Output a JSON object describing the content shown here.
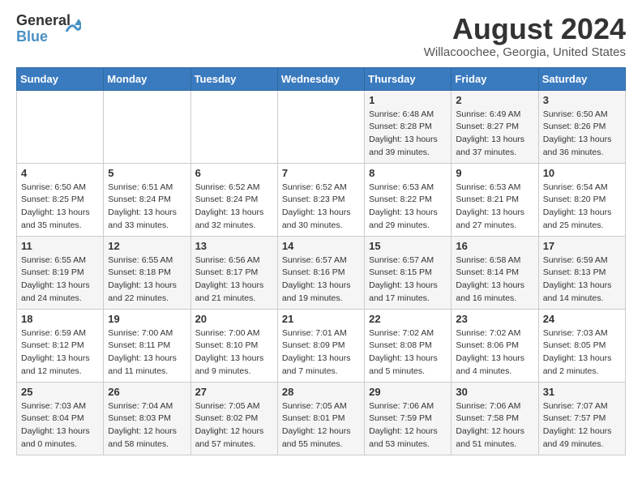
{
  "header": {
    "logo_general": "General",
    "logo_blue": "Blue",
    "month_year": "August 2024",
    "location": "Willacoochee, Georgia, United States"
  },
  "weekdays": [
    "Sunday",
    "Monday",
    "Tuesday",
    "Wednesday",
    "Thursday",
    "Friday",
    "Saturday"
  ],
  "weeks": [
    [
      {
        "day": "",
        "sunrise": "",
        "sunset": "",
        "daylight": ""
      },
      {
        "day": "",
        "sunrise": "",
        "sunset": "",
        "daylight": ""
      },
      {
        "day": "",
        "sunrise": "",
        "sunset": "",
        "daylight": ""
      },
      {
        "day": "",
        "sunrise": "",
        "sunset": "",
        "daylight": ""
      },
      {
        "day": "1",
        "sunrise": "Sunrise: 6:48 AM",
        "sunset": "Sunset: 8:28 PM",
        "daylight": "Daylight: 13 hours and 39 minutes."
      },
      {
        "day": "2",
        "sunrise": "Sunrise: 6:49 AM",
        "sunset": "Sunset: 8:27 PM",
        "daylight": "Daylight: 13 hours and 37 minutes."
      },
      {
        "day": "3",
        "sunrise": "Sunrise: 6:50 AM",
        "sunset": "Sunset: 8:26 PM",
        "daylight": "Daylight: 13 hours and 36 minutes."
      }
    ],
    [
      {
        "day": "4",
        "sunrise": "Sunrise: 6:50 AM",
        "sunset": "Sunset: 8:25 PM",
        "daylight": "Daylight: 13 hours and 35 minutes."
      },
      {
        "day": "5",
        "sunrise": "Sunrise: 6:51 AM",
        "sunset": "Sunset: 8:24 PM",
        "daylight": "Daylight: 13 hours and 33 minutes."
      },
      {
        "day": "6",
        "sunrise": "Sunrise: 6:52 AM",
        "sunset": "Sunset: 8:24 PM",
        "daylight": "Daylight: 13 hours and 32 minutes."
      },
      {
        "day": "7",
        "sunrise": "Sunrise: 6:52 AM",
        "sunset": "Sunset: 8:23 PM",
        "daylight": "Daylight: 13 hours and 30 minutes."
      },
      {
        "day": "8",
        "sunrise": "Sunrise: 6:53 AM",
        "sunset": "Sunset: 8:22 PM",
        "daylight": "Daylight: 13 hours and 29 minutes."
      },
      {
        "day": "9",
        "sunrise": "Sunrise: 6:53 AM",
        "sunset": "Sunset: 8:21 PM",
        "daylight": "Daylight: 13 hours and 27 minutes."
      },
      {
        "day": "10",
        "sunrise": "Sunrise: 6:54 AM",
        "sunset": "Sunset: 8:20 PM",
        "daylight": "Daylight: 13 hours and 25 minutes."
      }
    ],
    [
      {
        "day": "11",
        "sunrise": "Sunrise: 6:55 AM",
        "sunset": "Sunset: 8:19 PM",
        "daylight": "Daylight: 13 hours and 24 minutes."
      },
      {
        "day": "12",
        "sunrise": "Sunrise: 6:55 AM",
        "sunset": "Sunset: 8:18 PM",
        "daylight": "Daylight: 13 hours and 22 minutes."
      },
      {
        "day": "13",
        "sunrise": "Sunrise: 6:56 AM",
        "sunset": "Sunset: 8:17 PM",
        "daylight": "Daylight: 13 hours and 21 minutes."
      },
      {
        "day": "14",
        "sunrise": "Sunrise: 6:57 AM",
        "sunset": "Sunset: 8:16 PM",
        "daylight": "Daylight: 13 hours and 19 minutes."
      },
      {
        "day": "15",
        "sunrise": "Sunrise: 6:57 AM",
        "sunset": "Sunset: 8:15 PM",
        "daylight": "Daylight: 13 hours and 17 minutes."
      },
      {
        "day": "16",
        "sunrise": "Sunrise: 6:58 AM",
        "sunset": "Sunset: 8:14 PM",
        "daylight": "Daylight: 13 hours and 16 minutes."
      },
      {
        "day": "17",
        "sunrise": "Sunrise: 6:59 AM",
        "sunset": "Sunset: 8:13 PM",
        "daylight": "Daylight: 13 hours and 14 minutes."
      }
    ],
    [
      {
        "day": "18",
        "sunrise": "Sunrise: 6:59 AM",
        "sunset": "Sunset: 8:12 PM",
        "daylight": "Daylight: 13 hours and 12 minutes."
      },
      {
        "day": "19",
        "sunrise": "Sunrise: 7:00 AM",
        "sunset": "Sunset: 8:11 PM",
        "daylight": "Daylight: 13 hours and 11 minutes."
      },
      {
        "day": "20",
        "sunrise": "Sunrise: 7:00 AM",
        "sunset": "Sunset: 8:10 PM",
        "daylight": "Daylight: 13 hours and 9 minutes."
      },
      {
        "day": "21",
        "sunrise": "Sunrise: 7:01 AM",
        "sunset": "Sunset: 8:09 PM",
        "daylight": "Daylight: 13 hours and 7 minutes."
      },
      {
        "day": "22",
        "sunrise": "Sunrise: 7:02 AM",
        "sunset": "Sunset: 8:08 PM",
        "daylight": "Daylight: 13 hours and 5 minutes."
      },
      {
        "day": "23",
        "sunrise": "Sunrise: 7:02 AM",
        "sunset": "Sunset: 8:06 PM",
        "daylight": "Daylight: 13 hours and 4 minutes."
      },
      {
        "day": "24",
        "sunrise": "Sunrise: 7:03 AM",
        "sunset": "Sunset: 8:05 PM",
        "daylight": "Daylight: 13 hours and 2 minutes."
      }
    ],
    [
      {
        "day": "25",
        "sunrise": "Sunrise: 7:03 AM",
        "sunset": "Sunset: 8:04 PM",
        "daylight": "Daylight: 13 hours and 0 minutes."
      },
      {
        "day": "26",
        "sunrise": "Sunrise: 7:04 AM",
        "sunset": "Sunset: 8:03 PM",
        "daylight": "Daylight: 12 hours and 58 minutes."
      },
      {
        "day": "27",
        "sunrise": "Sunrise: 7:05 AM",
        "sunset": "Sunset: 8:02 PM",
        "daylight": "Daylight: 12 hours and 57 minutes."
      },
      {
        "day": "28",
        "sunrise": "Sunrise: 7:05 AM",
        "sunset": "Sunset: 8:01 PM",
        "daylight": "Daylight: 12 hours and 55 minutes."
      },
      {
        "day": "29",
        "sunrise": "Sunrise: 7:06 AM",
        "sunset": "Sunset: 7:59 PM",
        "daylight": "Daylight: 12 hours and 53 minutes."
      },
      {
        "day": "30",
        "sunrise": "Sunrise: 7:06 AM",
        "sunset": "Sunset: 7:58 PM",
        "daylight": "Daylight: 12 hours and 51 minutes."
      },
      {
        "day": "31",
        "sunrise": "Sunrise: 7:07 AM",
        "sunset": "Sunset: 7:57 PM",
        "daylight": "Daylight: 12 hours and 49 minutes."
      }
    ]
  ]
}
